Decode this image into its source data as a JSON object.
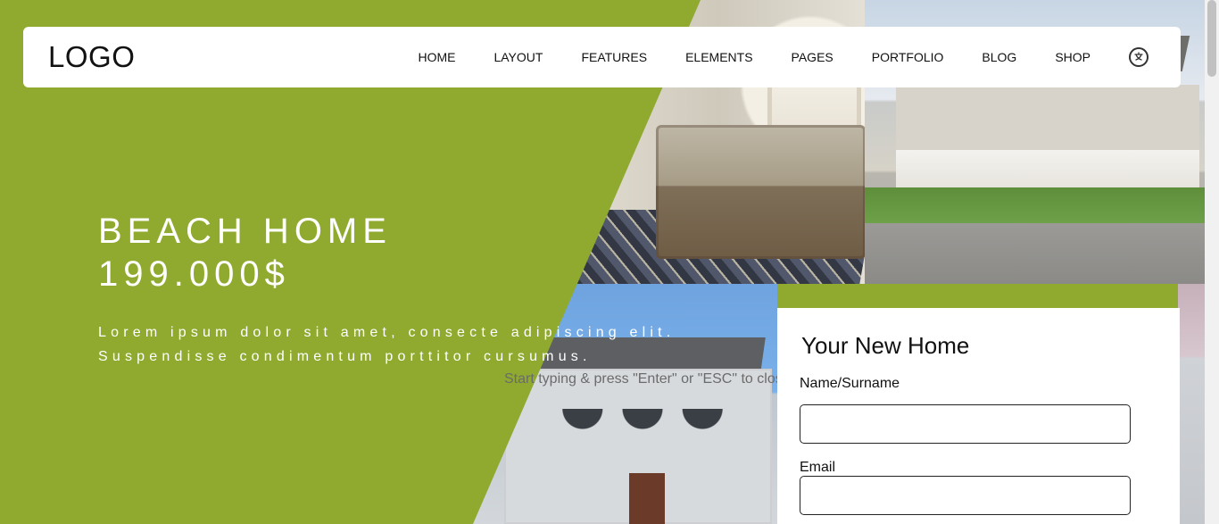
{
  "header": {
    "logo": "LOGO",
    "nav": [
      "HOME",
      "LAYOUT",
      "FEATURES",
      "ELEMENTS",
      "PAGES",
      "PORTFOLIO",
      "BLOG",
      "SHOP"
    ],
    "translate_icon": "translate-icon"
  },
  "hero": {
    "title_line1": "BEACH HOME",
    "title_line2": "199.000$",
    "desc_line1": "Lorem ipsum dolor sit amet, consecte adipiscing elit.",
    "desc_line2": "Suspendisse condimentum porttitor cursumus."
  },
  "search_hint": "Start typing & press \"Enter\" or \"ESC\" to close",
  "form": {
    "title": "Your New Home",
    "name_label": "Name/Surname",
    "email_label": "Email"
  },
  "colors": {
    "accent_green": "#8faa2f"
  }
}
